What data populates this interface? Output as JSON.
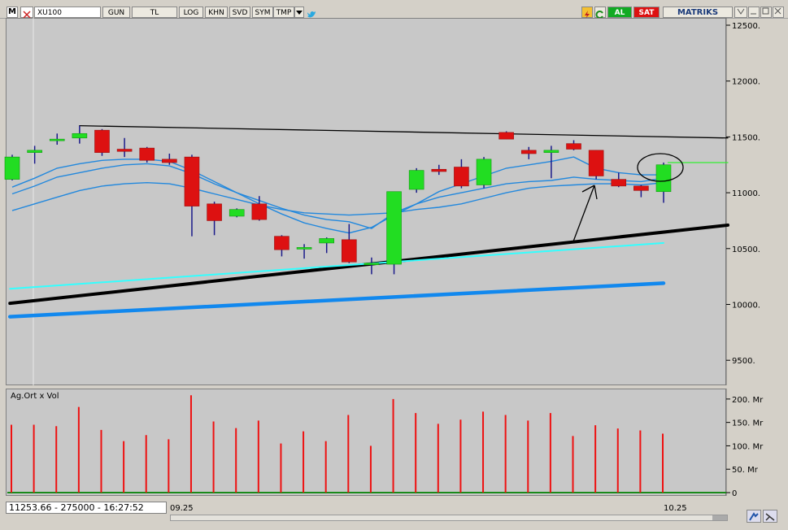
{
  "toolbar": {
    "m_label": "M",
    "symbol": "XU100",
    "buttons": [
      "GUN",
      "TL",
      "LOG",
      "KHN",
      "SVD",
      "SYM",
      "TMP"
    ],
    "al_label": "AL",
    "sat_label": "SAT",
    "brand": "MATRIKS"
  },
  "colors": {
    "up": "#22dd22",
    "down": "#dd1111",
    "ma": "#2288dd",
    "trend_cyan": "#33ffff",
    "trend_blue": "#1188ee",
    "volume": "#ee1111"
  },
  "chart_data": [
    {
      "type": "candlestick",
      "symbol": "XU100",
      "y_ticks": [
        "12500.",
        "12000.",
        "11500.",
        "11000.",
        "10500.",
        "10000.",
        "9500."
      ],
      "ylim": [
        9350,
        12550
      ],
      "grid": false,
      "candles": [
        {
          "o": 11120,
          "h": 11340,
          "l": 11110,
          "c": 11320
        },
        {
          "o": 11360,
          "h": 11420,
          "l": 11260,
          "c": 11380
        },
        {
          "o": 11470,
          "h": 11530,
          "l": 11430,
          "c": 11480
        },
        {
          "o": 11490,
          "h": 11600,
          "l": 11440,
          "c": 11530
        },
        {
          "o": 11560,
          "h": 11570,
          "l": 11330,
          "c": 11360
        },
        {
          "o": 11390,
          "h": 11490,
          "l": 11320,
          "c": 11370
        },
        {
          "o": 11400,
          "h": 11410,
          "l": 11270,
          "c": 11290
        },
        {
          "o": 11300,
          "h": 11350,
          "l": 11250,
          "c": 11270
        },
        {
          "o": 11320,
          "h": 11340,
          "l": 10610,
          "c": 10880
        },
        {
          "o": 10900,
          "h": 10920,
          "l": 10620,
          "c": 10750
        },
        {
          "o": 10790,
          "h": 10860,
          "l": 10780,
          "c": 10850
        },
        {
          "o": 10900,
          "h": 10970,
          "l": 10750,
          "c": 10760
        },
        {
          "o": 10610,
          "h": 10620,
          "l": 10430,
          "c": 10490
        },
        {
          "o": 10500,
          "h": 10540,
          "l": 10410,
          "c": 10510
        },
        {
          "o": 10550,
          "h": 10600,
          "l": 10460,
          "c": 10590
        },
        {
          "o": 10580,
          "h": 10720,
          "l": 10370,
          "c": 10380
        },
        {
          "o": 10360,
          "h": 10420,
          "l": 10270,
          "c": 10370
        },
        {
          "o": 10360,
          "h": 11010,
          "l": 10270,
          "c": 11010
        },
        {
          "o": 11030,
          "h": 11220,
          "l": 11000,
          "c": 11200
        },
        {
          "o": 11210,
          "h": 11250,
          "l": 11160,
          "c": 11190
        },
        {
          "o": 11230,
          "h": 11300,
          "l": 11040,
          "c": 11060
        },
        {
          "o": 11070,
          "h": 11320,
          "l": 11040,
          "c": 11300
        },
        {
          "o": 11540,
          "h": 11550,
          "l": 11480,
          "c": 11480
        },
        {
          "o": 11380,
          "h": 11410,
          "l": 11300,
          "c": 11350
        },
        {
          "o": 11360,
          "h": 11420,
          "l": 11130,
          "c": 11380
        },
        {
          "o": 11440,
          "h": 11470,
          "l": 11380,
          "c": 11390
        },
        {
          "o": 11380,
          "h": 11380,
          "l": 11120,
          "c": 11150
        },
        {
          "o": 11120,
          "h": 11180,
          "l": 11050,
          "c": 11060
        },
        {
          "o": 11060,
          "h": 11070,
          "l": 10960,
          "c": 11020
        },
        {
          "o": 11010,
          "h": 11270,
          "l": 10910,
          "c": 11250
        }
      ],
      "moving_averages": [
        [
          11050,
          11130,
          11220,
          11260,
          11290,
          11300,
          11300,
          11280,
          11200,
          11100,
          11000,
          10900,
          10810,
          10730,
          10680,
          10640,
          10690,
          10800,
          10900,
          11010,
          11080,
          11150,
          11220,
          11250,
          11280,
          11320,
          11220,
          11180,
          11160,
          11160
        ],
        [
          10990,
          11060,
          11140,
          11180,
          11220,
          11250,
          11260,
          11240,
          11170,
          11080,
          11000,
          10930,
          10860,
          10800,
          10760,
          10740,
          10680,
          10820,
          10900,
          10960,
          11000,
          11040,
          11080,
          11100,
          11110,
          11140,
          11120,
          11110,
          11100,
          11130
        ],
        [
          10840,
          10900,
          10960,
          11020,
          11060,
          11080,
          11090,
          11080,
          11040,
          10990,
          10940,
          10890,
          10850,
          10820,
          10810,
          10800,
          10810,
          10820,
          10850,
          10870,
          10900,
          10950,
          11000,
          11040,
          11060,
          11070,
          11080,
          11080,
          11070,
          11090
        ]
      ],
      "trendlines": [
        {
          "name": "resistance",
          "color": "#000000",
          "from": [
            3,
            11600
          ],
          "to": [
            32,
            11490
          ]
        },
        {
          "name": "support",
          "color": "#000000",
          "from": [
            -0.1,
            10010
          ],
          "to": [
            32,
            10710
          ]
        },
        {
          "name": "cyan",
          "color": "#33ffff",
          "from": [
            -0.1,
            10140
          ],
          "to": [
            29,
            10550
          ]
        },
        {
          "name": "blue",
          "color": "#1188ee",
          "from": [
            -0.1,
            9890
          ],
          "to": [
            29,
            10190
          ]
        },
        {
          "name": "target",
          "color": "#33ee33",
          "from": [
            29.2,
            11270
          ],
          "to": [
            32,
            11270
          ]
        }
      ]
    },
    {
      "type": "bar",
      "title": "Ag.Ort x Vol",
      "y_ticks": [
        "200. Mr",
        "150. Mr",
        "100. Mr",
        "50. Mr",
        "0"
      ],
      "ylim": [
        0,
        210
      ],
      "values": [
        145,
        145,
        142,
        183,
        134,
        110,
        123,
        114,
        208,
        152,
        138,
        154,
        105,
        131,
        110,
        166,
        100,
        200,
        170,
        147,
        156,
        173,
        166,
        154,
        170,
        121,
        144,
        137,
        133,
        126
      ]
    }
  ],
  "x_dates": [
    "09.25",
    "10.25"
  ],
  "status": "11253.66 - 275000 - 16:27:52"
}
